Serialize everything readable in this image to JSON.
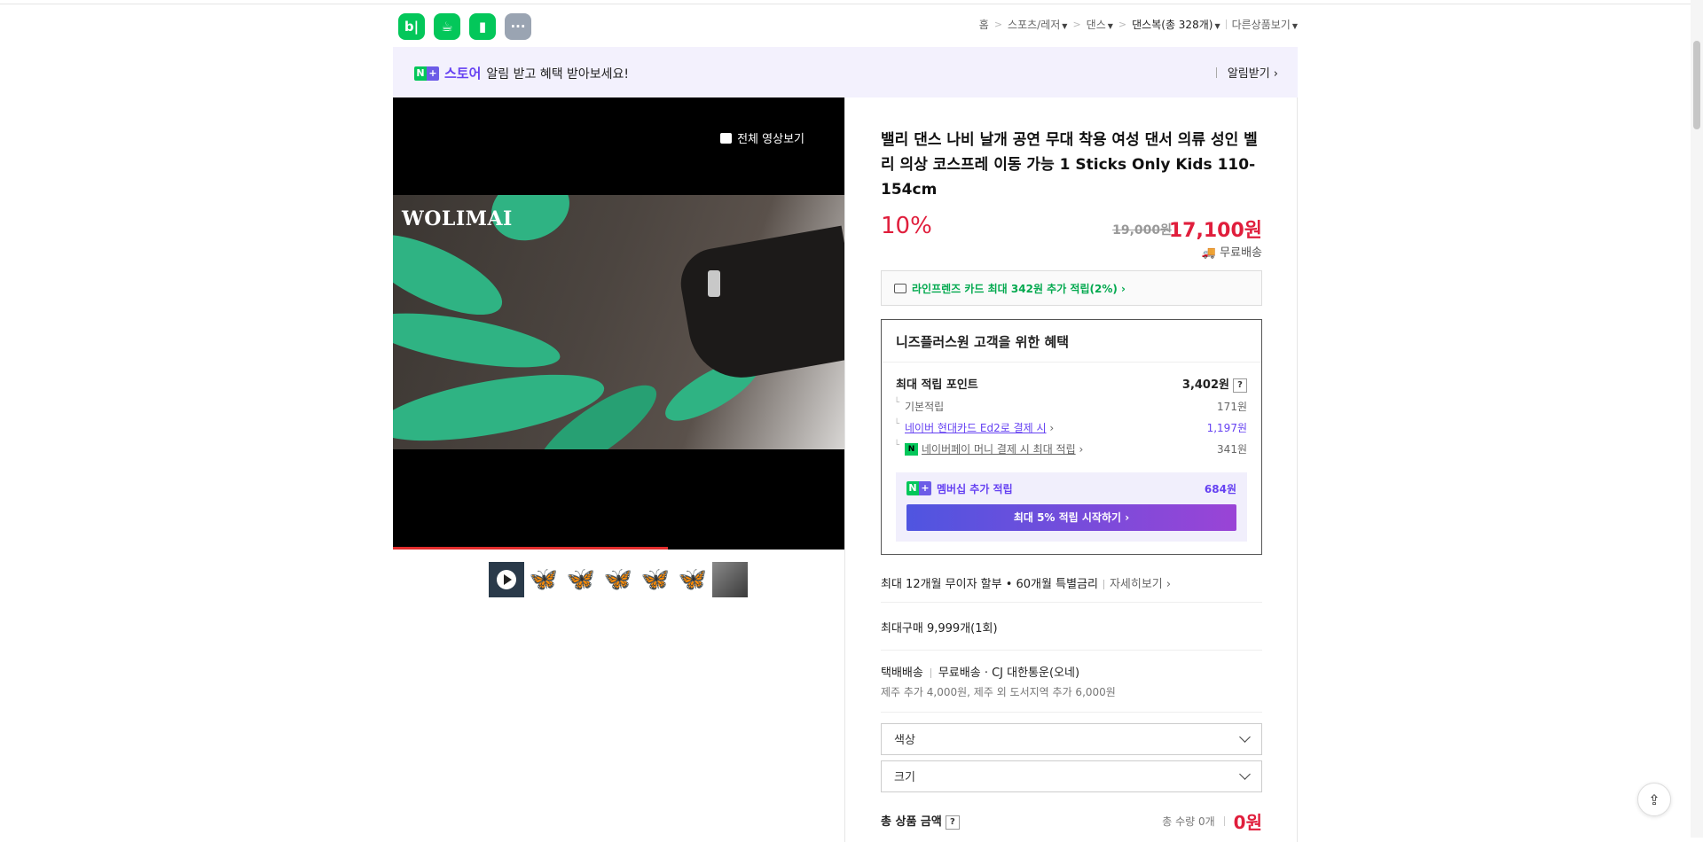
{
  "header": {
    "apps": [
      {
        "icon": "blog-icon",
        "label": "b|"
      },
      {
        "icon": "cafe-icon",
        "label": "☕"
      },
      {
        "icon": "bookmark-icon",
        "label": "▮"
      },
      {
        "icon": "more-icon",
        "label": "···"
      }
    ],
    "breadcrumb": {
      "home": "홈",
      "cat1": "스포츠/레저",
      "cat2": "댄스",
      "cat3": "댄스복(총 328개)",
      "other": "다른상품보기"
    }
  },
  "banner": {
    "nplus_n": "N",
    "nplus_p": "+",
    "store": "스토어",
    "message": "알림 받고 혜택 받아보세요!",
    "action": "알림받기 ›"
  },
  "media": {
    "video_button": "전체 영상보기",
    "brand": "WOLIMAI",
    "progress_percent": 61
  },
  "thumbnails": [
    "play",
    "🦋",
    "🦋",
    "🦋",
    "🦋",
    "🦋",
    "img"
  ],
  "product": {
    "title": "밸리 댄스 나비 날개 공연 무대 착용 여성 댄서 의류 성인 벨리 의상 코스프레 이동 가능 1 Sticks Only Kids 110-154cm",
    "discount_rate": "10%",
    "original_price": "19,000원",
    "sale_price": "17,100원",
    "shipping": "무료배송"
  },
  "card_promo": "라인프렌즈 카드 최대 342원 추가 적립(2%) ›",
  "benefits": {
    "title": "니즈플러스원 고객을 위한 혜택",
    "max_points_label": "최대 적립 포인트",
    "max_points_value": "3,402원",
    "qmark": "?",
    "rows": [
      {
        "label": "기본적립",
        "value": "171원"
      },
      {
        "label": "네이버 현대카드 Ed2로 결제 시",
        "value": "1,197원"
      },
      {
        "label": "네이버페이 머니 결제 시 최대 적립",
        "value": "341원"
      }
    ],
    "npay_badge": "N",
    "arrow": "›",
    "member_label": "멤버십 추가 적립",
    "member_value": "684원",
    "cta": "최대 5% 적립 시작하기 ›"
  },
  "installment": {
    "text": "최대 12개월 무이자 할부 • 60개월 특별금리",
    "link": "자세히보기 ›"
  },
  "max_purchase": "최대구매 9,999개(1회)",
  "delivery": {
    "method": "택배배송",
    "fee": "무료배송",
    "carrier": "· CJ 대한통운(오네)",
    "extra": "제주 추가 4,000원, 제주 외 도서지역 추가 6,000원"
  },
  "options": [
    {
      "label": "색상"
    },
    {
      "label": "크기"
    }
  ],
  "total": {
    "label": "총 상품 금액",
    "qmark": "?",
    "qty": "총 수량 0개",
    "amount": "0원"
  },
  "colors": {
    "accent_purple": "#6541f2",
    "price_red": "#e01e3c",
    "naver_green": "#03c75a"
  }
}
